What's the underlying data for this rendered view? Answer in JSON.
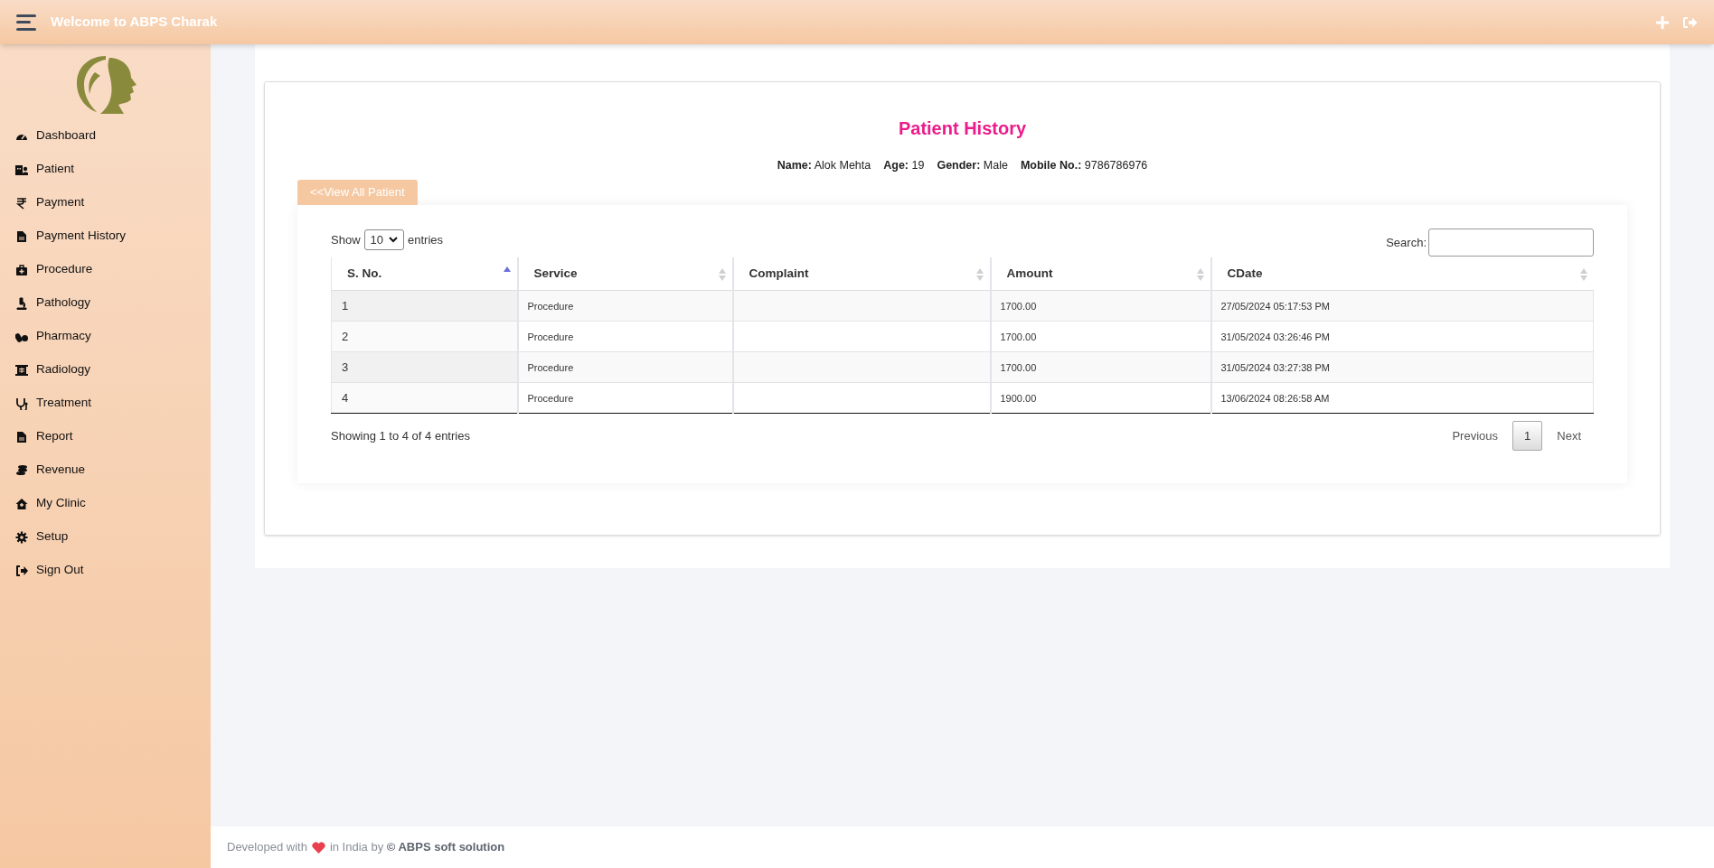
{
  "header": {
    "title": "Welcome to ABPS Charak"
  },
  "sidebar": {
    "items": [
      {
        "label": "Dashboard",
        "selected": false
      },
      {
        "label": "Patient",
        "selected": false
      },
      {
        "label": "Payment",
        "selected": false
      },
      {
        "label": "Payment History",
        "selected": false
      },
      {
        "label": "Procedure",
        "selected": false
      },
      {
        "label": "Pathology",
        "selected": false
      },
      {
        "label": "Pharmacy",
        "selected": false
      },
      {
        "label": "Radiology",
        "selected": false
      },
      {
        "label": "Treatment",
        "selected": false
      },
      {
        "label": "Report",
        "selected": false
      },
      {
        "label": "Revenue",
        "selected": false
      },
      {
        "label": "My Clinic",
        "selected": false
      },
      {
        "label": "Setup",
        "selected": false
      },
      {
        "label": "Sign Out",
        "selected": false
      }
    ]
  },
  "page": {
    "title": "Patient History",
    "info": [
      {
        "label": "Name:",
        "value": "Alok Mehta"
      },
      {
        "label": "Age:",
        "value": "19"
      },
      {
        "label": "Gender:",
        "value": "Male"
      },
      {
        "label": "Mobile No.:",
        "value": "9786786976"
      }
    ],
    "back_button": "<<View All Patient"
  },
  "table_controls": {
    "show_label": "Show",
    "page_size": "10",
    "entries_label": "entries",
    "search_label": "Search:"
  },
  "table": {
    "columns": [
      {
        "label": "S. No.",
        "sorted": true
      },
      {
        "label": "Service",
        "sorted": false
      },
      {
        "label": "Complaint",
        "sorted": false
      },
      {
        "label": "Amount",
        "sorted": false
      },
      {
        "label": "CDate",
        "sorted": false
      }
    ],
    "rows": [
      [
        "1",
        "Procedure",
        "",
        "1700.00",
        "27/05/2024 05:17:53 PM"
      ],
      [
        "2",
        "Procedure",
        "",
        "1700.00",
        "31/05/2024 03:26:46 PM"
      ],
      [
        "3",
        "Procedure",
        "",
        "1700.00",
        "31/05/2024 03:27:38 PM"
      ],
      [
        "4",
        "Procedure",
        "",
        "1900.00",
        "13/06/2024 08:26:58 AM"
      ]
    ]
  },
  "table_footer": {
    "info": "Showing 1 to 4 of 4 entries",
    "pagination": [
      {
        "label": "Previous",
        "selected": false
      },
      {
        "label": "1",
        "selected": true
      },
      {
        "label": "Next",
        "selected": false
      }
    ]
  },
  "footer": {
    "before": "Developed with",
    "after": "in India by **© ABPS soft solution**"
  }
}
